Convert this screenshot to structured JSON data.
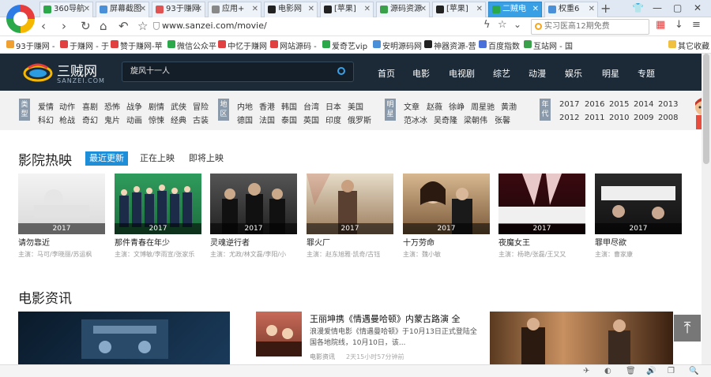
{
  "browser": {
    "tabs": [
      {
        "label": "360导航",
        "icon_color": "#2aa84a"
      },
      {
        "label": "屏幕截图",
        "icon_color": "#4a90d9"
      },
      {
        "label": "93于赚网",
        "icon_color": "#e05353"
      },
      {
        "label": "应用+",
        "icon_color": "#888888"
      },
      {
        "label": "电影网",
        "icon_color": "#222222"
      },
      {
        "label": "[苹果]",
        "icon_color": "#222222"
      },
      {
        "label": "源码资源",
        "icon_color": "#3aa04a"
      },
      {
        "label": "[苹果]",
        "icon_color": "#222222"
      },
      {
        "label": "二贼电",
        "icon_color": "#ffffff",
        "active": true
      },
      {
        "label": "权重6",
        "icon_color": "#4a90d9"
      }
    ],
    "address": "www.sanzei.com/movie/",
    "search_placeholder": "实习医高12期免费",
    "bookmarks": [
      {
        "label": "93于赚网 -",
        "color": "#f0a030"
      },
      {
        "label": "于赚网 - 于",
        "color": "#e04040"
      },
      {
        "label": "赞于赚网-苹",
        "color": "#e04040"
      },
      {
        "label": "微信公众平",
        "color": "#2aa84a"
      },
      {
        "label": "中忆于赚网 -",
        "color": "#e04040"
      },
      {
        "label": "网站源码 -",
        "color": "#e04040"
      },
      {
        "label": "爱奇艺vip",
        "color": "#2aa84a"
      },
      {
        "label": "安明源码网",
        "color": "#4a90d9"
      },
      {
        "label": "神器资源-营",
        "color": "#222222"
      },
      {
        "label": "百度指数",
        "color": "#4a70d9"
      },
      {
        "label": "互站网 - 国",
        "color": "#3aa04a"
      },
      {
        "label": "其它收藏",
        "color": "#f0c040"
      }
    ],
    "icons": {
      "back": "‹",
      "forward": "›",
      "reload": "↻",
      "home": "⌂",
      "undo": "↶",
      "star": "☆",
      "plus": "+",
      "flash": "ϟ",
      "dropdown": "⌄",
      "bm_star": "☆",
      "scissors": "✂",
      "apps": "▦",
      "download": "↓",
      "min": "—",
      "max": "▢",
      "close": "✕",
      "status": [
        "✈",
        "◐",
        "🗑",
        "🔊",
        "❐",
        "🔍"
      ]
    }
  },
  "site": {
    "name": "三贼网",
    "sub": "SANZEI.COM",
    "search_value": "旋风十一人",
    "nav": [
      "首页",
      "电影",
      "电视剧",
      "综艺",
      "动漫",
      "娱乐",
      "明星",
      "专题"
    ],
    "nav_active": 1,
    "filters": {
      "type_label": "类型",
      "types_row1": [
        "爱情",
        "动作",
        "喜剧",
        "恐怖",
        "战争",
        "剧情",
        "武侠",
        "冒险"
      ],
      "types_row2": [
        "科幻",
        "枪战",
        "奇幻",
        "鬼片",
        "动画",
        "惊悚",
        "经典",
        "古装"
      ],
      "region_label": "地区",
      "regions_row1": [
        "内地",
        "香港",
        "韩国",
        "台湾",
        "日本",
        "美国"
      ],
      "regions_row2": [
        "德国",
        "法国",
        "泰国",
        "英国",
        "印度",
        "俄罗斯"
      ],
      "star_label": "明星",
      "stars_row1": [
        "文章",
        "赵薇",
        "徐峥",
        "周星驰",
        "黄渤"
      ],
      "stars_row2": [
        "范冰冰",
        "吴奇隆",
        "梁朝伟",
        "张馨"
      ],
      "year_label": "年代",
      "years_row1": [
        "2017",
        "2016",
        "2015",
        "2014",
        "2013"
      ],
      "years_row2": [
        "2012",
        "2011",
        "2010",
        "2009",
        "2008"
      ]
    },
    "cinema": {
      "heading": "影院热映",
      "tabs": [
        "最近更新",
        "正在上映",
        "即将上映"
      ],
      "active_tab": 0,
      "movies": [
        {
          "title": "请勿靠近",
          "year": "2017",
          "cast": "主演：马可/李晓丽/苏运枫"
        },
        {
          "title": "那件青春在年少",
          "year": "2017",
          "cast": "主演：文博敏/李雨宣/张家乐"
        },
        {
          "title": "灵魂逆行者",
          "year": "2017",
          "cast": "主演：尤政/林文磊/李阳/小"
        },
        {
          "title": "罪火厂",
          "year": "2017",
          "cast": "主演：赵东旭雅·凯奇/古钰"
        },
        {
          "title": "十万劳命",
          "year": "2017",
          "cast": "主演：魏小敏"
        },
        {
          "title": "夜魔女王",
          "year": "2017",
          "cast": "主演：杨艳/张磊/王又又"
        },
        {
          "title": "罪甲尽欲",
          "year": "2017",
          "cast": "主演：曹家康"
        }
      ]
    },
    "news": {
      "heading": "电影资讯",
      "item_title": "王丽坤携《情遇曼哈顿》内蒙古路演 全",
      "item_desc": "浪漫爱情电影《情遇曼哈顿》于10月13日正式登陆全国各地院线，10月10日，该...",
      "item_category": "电影资讯",
      "item_time": "2天15小时57分钟前"
    }
  }
}
